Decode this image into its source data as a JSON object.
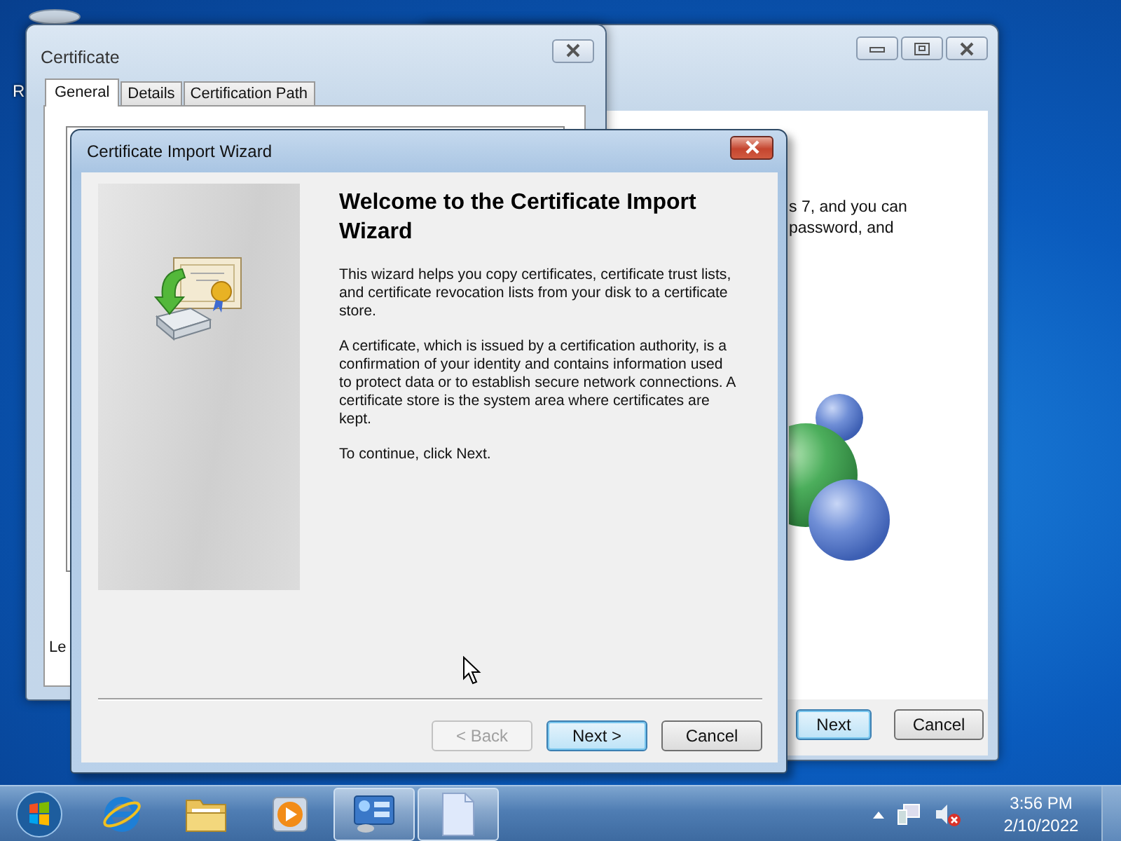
{
  "desktop_icons": [
    {
      "label": "R"
    }
  ],
  "back_window": {
    "text_lines": [
      "s 7, and you can",
      "password, and"
    ],
    "buttons": [
      {
        "label": "Next",
        "default": true
      },
      {
        "label": "Cancel",
        "default": false
      }
    ]
  },
  "certificate_window": {
    "title": "Certificate",
    "tabs": [
      {
        "label": "General",
        "selected": true
      },
      {
        "label": "Details",
        "selected": false
      },
      {
        "label": "Certification Path",
        "selected": false
      }
    ],
    "content_text": "Le"
  },
  "wizard": {
    "title": "Certificate Import Wizard",
    "heading": "Welcome to the Certificate Import Wizard",
    "paragraphs": [
      "This wizard helps you copy certificates, certificate trust lists, and certificate revocation lists from your disk to a certificate store.",
      "A certificate, which is issued by a certification authority, is a confirmation of your identity and contains information used to protect data or to establish secure network connections. A certificate store is the system area where certificates are kept.",
      "To continue, click Next."
    ],
    "buttons": [
      {
        "label": "< Back",
        "disabled": true,
        "default": false
      },
      {
        "label": "Next >",
        "disabled": false,
        "default": true
      },
      {
        "label": "Cancel",
        "disabled": false,
        "default": false
      }
    ]
  },
  "taskbar": {
    "items": [
      {
        "kind": "browser",
        "open": false
      },
      {
        "kind": "folder",
        "open": false
      },
      {
        "kind": "media",
        "open": false
      },
      {
        "kind": "control-panel",
        "open": true
      },
      {
        "kind": "document",
        "open": true
      }
    ],
    "tray": {
      "volume_muted": true,
      "time": "3:56 PM",
      "date": "2/10/2022"
    }
  }
}
